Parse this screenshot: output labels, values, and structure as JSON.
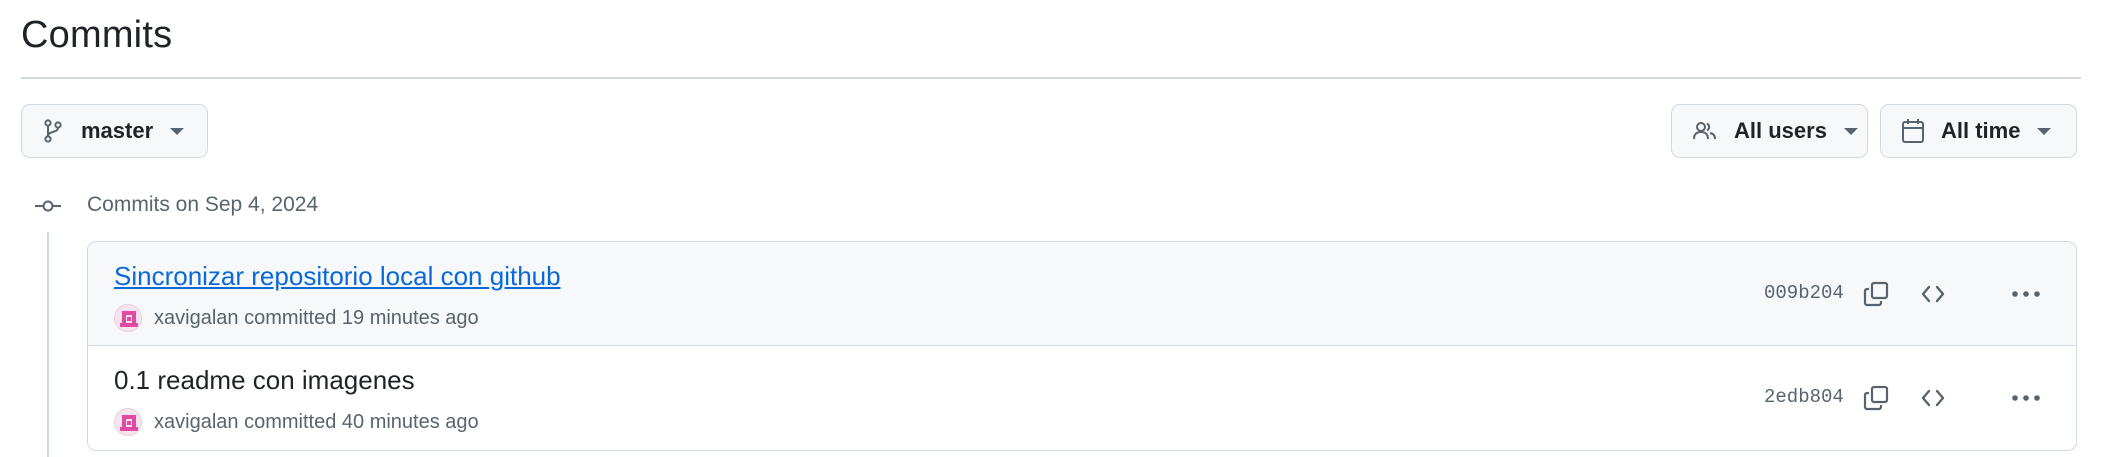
{
  "page": {
    "title": "Commits"
  },
  "filters": {
    "branch": {
      "label": "master",
      "icon": "git-branch-icon"
    },
    "users": {
      "label": "All users",
      "icon": "people-icon"
    },
    "time": {
      "label": "All time",
      "icon": "calendar-icon"
    }
  },
  "timeline": {
    "date_label": "Commits on Sep 4, 2024"
  },
  "commits": [
    {
      "title": "Sincronizar repositorio local con github",
      "author": "xavigalan",
      "action": "committed",
      "time": "19 minutes ago",
      "sha": "009b204"
    },
    {
      "title": "0.1 readme con imagenes",
      "author": "xavigalan",
      "action": "committed",
      "time": "40 minutes ago",
      "sha": "2edb804"
    }
  ],
  "colors": {
    "link": "#0969da",
    "muted": "#59636e",
    "border": "#d1d9e0",
    "avatar": "#e04aa0"
  }
}
